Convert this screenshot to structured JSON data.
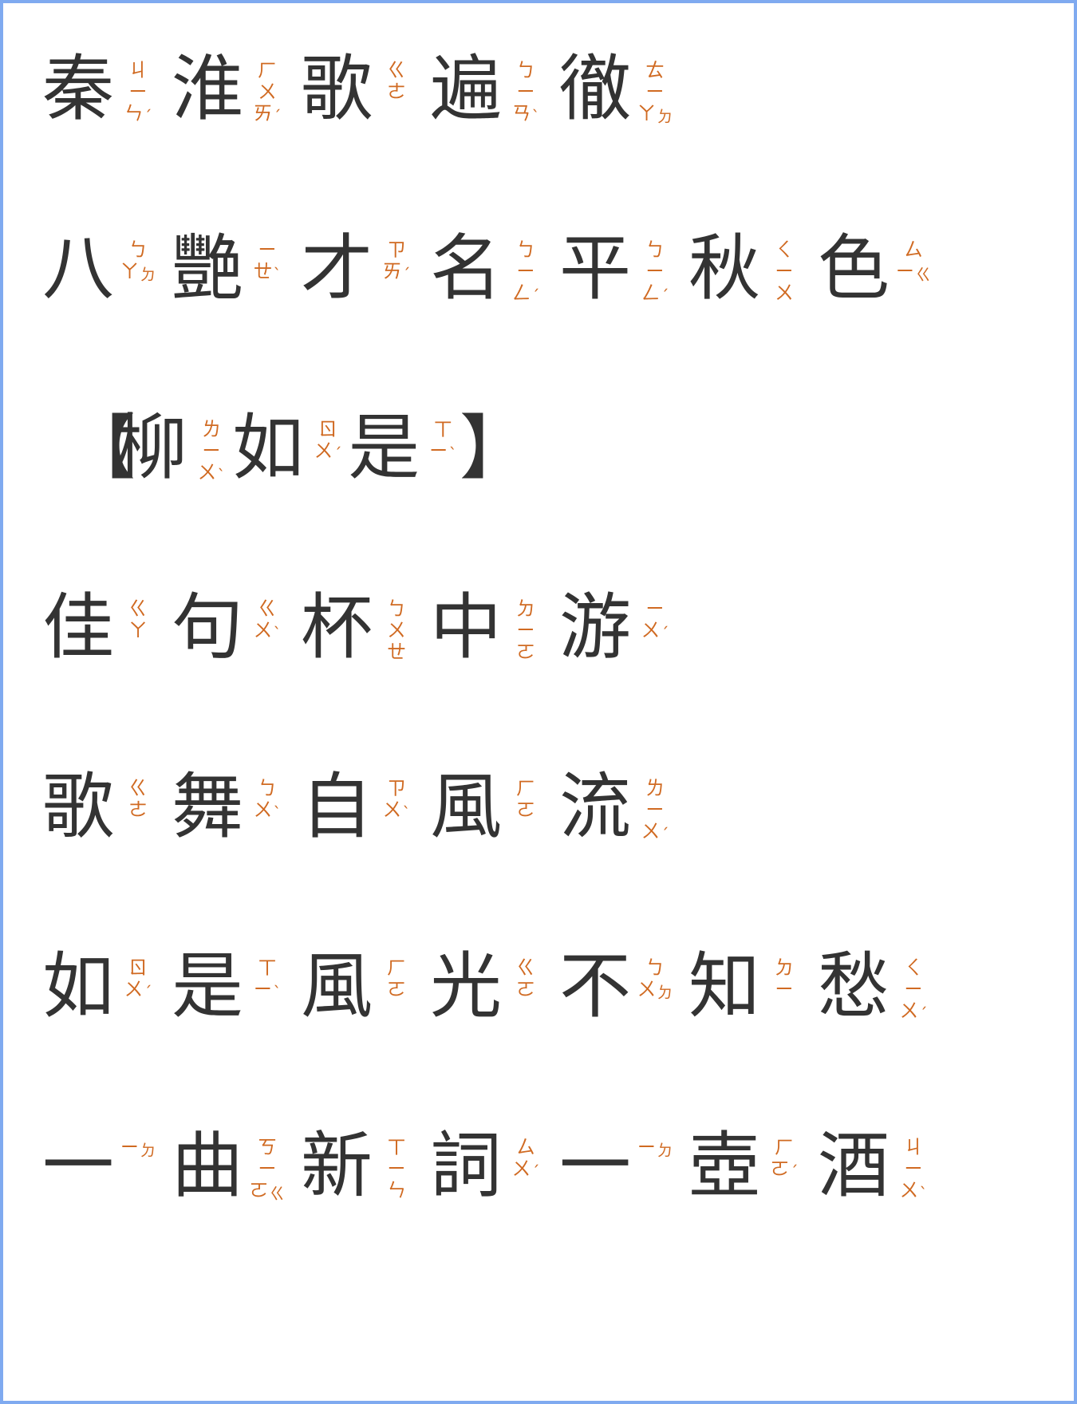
{
  "lines": [
    {
      "open": "",
      "close": "",
      "units": [
        {
          "char": "秦",
          "zhuyin": [
            "ㄐ",
            "ㄧ",
            "ㄣ"
          ],
          "tone": "ˊ"
        },
        {
          "char": "淮",
          "zhuyin": [
            "ㄏ",
            "ㄨ",
            "ㄞ"
          ],
          "tone": "ˊ"
        },
        {
          "char": "歌",
          "zhuyin": [
            "ㄍ",
            "ㄜ"
          ],
          "tone": ""
        },
        {
          "char": "遍",
          "zhuyin": [
            "ㄅ",
            "ㄧ",
            "ㄢ"
          ],
          "tone": "ˋ"
        },
        {
          "char": "徹",
          "zhuyin": [
            "ㄊ",
            "ㄧ",
            "ㄚ"
          ],
          "tone": "ㄉ"
        }
      ]
    },
    {
      "open": "",
      "close": "",
      "units": [
        {
          "char": "八",
          "zhuyin": [
            "ㄅ",
            "ㄚ"
          ],
          "tone": "ㄉ"
        },
        {
          "char": "艷",
          "zhuyin": [
            "ㄧ",
            "ㄝ"
          ],
          "tone": "ˋ"
        },
        {
          "char": "才",
          "zhuyin": [
            "ㄗ",
            "ㄞ"
          ],
          "tone": "ˊ"
        },
        {
          "char": "名",
          "zhuyin": [
            "ㄅ",
            "ㄧ",
            "ㄥ"
          ],
          "tone": "ˊ"
        },
        {
          "char": "平",
          "zhuyin": [
            "ㄅ",
            "ㄧ",
            "ㄥ"
          ],
          "tone": "ˊ"
        },
        {
          "char": "秋",
          "zhuyin": [
            "ㄑ",
            "ㄧ",
            "ㄨ"
          ],
          "tone": ""
        },
        {
          "char": "色",
          "zhuyin": [
            "ㄙ",
            "ㄧ"
          ],
          "tone": "ㄍ"
        }
      ]
    },
    {
      "open": "【",
      "close": "】",
      "units": [
        {
          "char": "柳",
          "zhuyin": [
            "ㄌ",
            "ㄧ",
            "ㄨ"
          ],
          "tone": "ˋ"
        },
        {
          "char": "如",
          "zhuyin": [
            "ㄖ",
            "ㄨ"
          ],
          "tone": "ˊ"
        },
        {
          "char": "是",
          "zhuyin": [
            "ㄒ",
            "ㄧ"
          ],
          "tone": "ˋ"
        }
      ]
    },
    {
      "open": "",
      "close": "",
      "units": [
        {
          "char": "佳",
          "zhuyin": [
            "ㄍ",
            "ㄚ"
          ],
          "tone": ""
        },
        {
          "char": "句",
          "zhuyin": [
            "ㄍ",
            "ㄨ"
          ],
          "tone": "ˋ"
        },
        {
          "char": "杯",
          "zhuyin": [
            "ㄅ",
            "ㄨ",
            "ㄝ"
          ],
          "tone": ""
        },
        {
          "char": "中",
          "zhuyin": [
            "ㄉ",
            "ㄧ",
            "ㄛ"
          ],
          "tone": ""
        },
        {
          "char": "游",
          "zhuyin": [
            "ㄧ",
            "ㄨ"
          ],
          "tone": "ˊ"
        }
      ]
    },
    {
      "open": "",
      "close": "",
      "units": [
        {
          "char": "歌",
          "zhuyin": [
            "ㄍ",
            "ㄜ"
          ],
          "tone": ""
        },
        {
          "char": "舞",
          "zhuyin": [
            "ㄅ",
            "ㄨ"
          ],
          "tone": "ˋ"
        },
        {
          "char": "自",
          "zhuyin": [
            "ㄗ",
            "ㄨ"
          ],
          "tone": "ˋ"
        },
        {
          "char": "風",
          "zhuyin": [
            "ㄏ",
            "ㄛ"
          ],
          "tone": ""
        },
        {
          "char": "流",
          "zhuyin": [
            "ㄌ",
            "ㄧ",
            "ㄨ"
          ],
          "tone": "ˊ"
        }
      ]
    },
    {
      "open": "",
      "close": "",
      "units": [
        {
          "char": "如",
          "zhuyin": [
            "ㄖ",
            "ㄨ"
          ],
          "tone": "ˊ"
        },
        {
          "char": "是",
          "zhuyin": [
            "ㄒ",
            "ㄧ"
          ],
          "tone": "ˋ"
        },
        {
          "char": "風",
          "zhuyin": [
            "ㄏ",
            "ㄛ"
          ],
          "tone": ""
        },
        {
          "char": "光",
          "zhuyin": [
            "ㄍ",
            "ㄛ"
          ],
          "tone": ""
        },
        {
          "char": "不",
          "zhuyin": [
            "ㄅ",
            "ㄨ"
          ],
          "tone": "ㄉ"
        },
        {
          "char": "知",
          "zhuyin": [
            "ㄉ",
            "ㄧ"
          ],
          "tone": ""
        },
        {
          "char": "愁",
          "zhuyin": [
            "ㄑ",
            "ㄧ",
            "ㄨ"
          ],
          "tone": "ˊ"
        }
      ]
    },
    {
      "open": "",
      "close": "",
      "units": [
        {
          "char": "一",
          "zhuyin": [
            "ㄧ"
          ],
          "tone": "ㄉ"
        },
        {
          "char": "曲",
          "zhuyin": [
            "ㄎ",
            "ㄧ",
            "ㄛ"
          ],
          "tone": "ㄍ"
        },
        {
          "char": "新",
          "zhuyin": [
            "ㄒ",
            "ㄧ",
            "ㄣ"
          ],
          "tone": ""
        },
        {
          "char": "詞",
          "zhuyin": [
            "ㄙ",
            "ㄨ"
          ],
          "tone": "ˊ"
        },
        {
          "char": "一",
          "zhuyin": [
            "ㄧ"
          ],
          "tone": "ㄉ"
        },
        {
          "char": "壺",
          "zhuyin": [
            "ㄏ",
            "ㄛ"
          ],
          "tone": "ˊ"
        },
        {
          "char": "酒",
          "zhuyin": [
            "ㄐ",
            "ㄧ",
            "ㄨ"
          ],
          "tone": "ˋ"
        }
      ]
    }
  ]
}
